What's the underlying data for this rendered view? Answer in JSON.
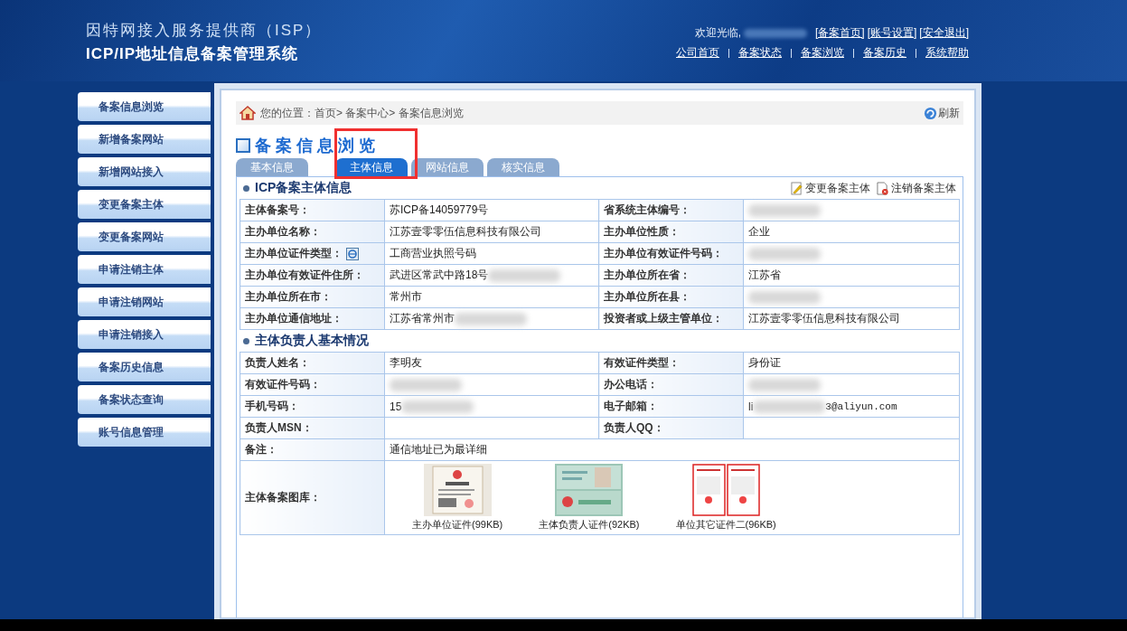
{
  "header": {
    "title_line1": "因特网接入服务提供商（ISP）",
    "title_line2": "ICP/IP地址信息备案管理系统",
    "welcome": "欢迎光临,",
    "top_links": [
      "[备案首页]",
      "[账号设置]",
      "[安全退出]"
    ],
    "nav_links": [
      "公司首页",
      "备案状态",
      "备案浏览",
      "备案历史",
      "系统帮助"
    ]
  },
  "sidebar": {
    "items": [
      {
        "label": "备案信息浏览"
      },
      {
        "label": "新增备案网站"
      },
      {
        "label": "新增网站接入"
      },
      {
        "label": "变更备案主体"
      },
      {
        "label": "变更备案网站"
      },
      {
        "label": "申请注销主体"
      },
      {
        "label": "申请注销网站"
      },
      {
        "label": "申请注销接入"
      },
      {
        "label": "备案历史信息"
      },
      {
        "label": "备案状态查询"
      },
      {
        "label": "账号信息管理"
      }
    ]
  },
  "breadcrumb": "您的位置：首页> 备案中心>  备案信息浏览",
  "refresh": "刷新",
  "page_title": "备案信息浏览",
  "tabs": [
    {
      "label": "基本信息",
      "selected": false
    },
    {
      "label": "主体信息",
      "selected": true
    },
    {
      "label": "网站信息",
      "selected": false
    },
    {
      "label": "核实信息",
      "selected": false
    }
  ],
  "sections": [
    {
      "title": "ICP备案主体信息",
      "actions": [
        {
          "label": "变更备案主体",
          "kind": "edit"
        },
        {
          "label": "注销备案主体",
          "kind": "delete"
        }
      ],
      "rows": [
        {
          "fields": [
            {
              "label": "主体备案号：",
              "value": "苏ICP备14059779号"
            },
            {
              "label": "省系统主体编号：",
              "redacted": true
            }
          ]
        },
        {
          "fields": [
            {
              "label": "主办单位名称：",
              "value": "江苏壹零零伍信息科技有限公司"
            },
            {
              "label": "主办单位性质：",
              "value": "企业"
            }
          ]
        },
        {
          "fields": [
            {
              "label": "主办单位证件类型：",
              "help_icon": true,
              "value": "工商营业执照号码"
            },
            {
              "label": "主办单位有效证件号码：",
              "redacted": true
            }
          ]
        },
        {
          "fields": [
            {
              "label": "主办单位有效证件住所：",
              "value": "武进区常武中路18号",
              "redacted": true
            },
            {
              "label": "主办单位所在省：",
              "value": "江苏省"
            }
          ]
        },
        {
          "fields": [
            {
              "label": "主办单位所在市：",
              "value": "常州市"
            },
            {
              "label": "主办单位所在县：",
              "redacted": true
            }
          ]
        },
        {
          "fields": [
            {
              "label": "主办单位通信地址：",
              "value": "江苏省常州市",
              "redacted": true
            },
            {
              "label": "投资者或上级主管单位：",
              "value": "江苏壹零零伍信息科技有限公司"
            }
          ]
        }
      ]
    },
    {
      "title": "主体负责人基本情况",
      "rows": [
        {
          "fields": [
            {
              "label": "负责人姓名：",
              "value": "李明友"
            },
            {
              "label": "有效证件类型：",
              "value": "身份证"
            }
          ]
        },
        {
          "fields": [
            {
              "label": "有效证件号码：",
              "redacted": true
            },
            {
              "label": "办公电话：",
              "redacted": true
            }
          ]
        },
        {
          "fields": [
            {
              "label": "手机号码：",
              "value": "15",
              "redacted": true
            },
            {
              "label": "电子邮箱：",
              "value": "li",
              "redacted": true,
              "value_end": "3@aliyun.com"
            }
          ]
        },
        {
          "fields": [
            {
              "label": "负责人MSN："
            },
            {
              "label": "负责人QQ："
            }
          ]
        },
        {
          "fields": [
            {
              "label": "备注：",
              "value": "通信地址已为最详细"
            }
          ]
        },
        {
          "fields": [
            {
              "label": "主体备案图库：",
              "gallery": [
                {
                  "caption": "主办单位证件(99KB)",
                  "kind": "license"
                },
                {
                  "caption": "主体负责人证件(92KB)",
                  "kind": "idcard"
                },
                {
                  "caption": "单位其它证件二(96KB)",
                  "kind": "document"
                }
              ]
            }
          ]
        }
      ]
    }
  ]
}
